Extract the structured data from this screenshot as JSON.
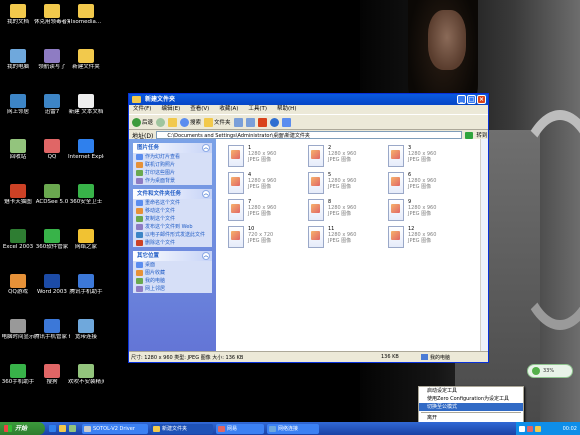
{
  "desktop_icons": [
    {
      "label": "我的文档",
      "color": "#f2c94c"
    },
    {
      "label": "休克用领毒者集",
      "color": "#f2c94c"
    },
    {
      "label": "Isomedia...",
      "color": "#f2c94c"
    },
    {
      "label": "我的电脑",
      "color": "#6fa8dc"
    },
    {
      "label": "领航读写了",
      "color": "#8e7cc3"
    },
    {
      "label": "新建文件夹",
      "color": "#f2c94c"
    },
    {
      "label": "网上邻居",
      "color": "#3d85c6"
    },
    {
      "label": "迅雷7",
      "color": "#3d85c6"
    },
    {
      "label": "新建 文本文档",
      "color": "#eeeeee"
    },
    {
      "label": "回收站",
      "color": "#93c47d"
    },
    {
      "label": "QQ",
      "color": "#e06666"
    },
    {
      "label": "Internet Explorer",
      "color": "#2f80ed"
    },
    {
      "label": "魅卡天猫图",
      "color": "#cc4125"
    },
    {
      "label": "ACDSee 5.0",
      "color": "#6aa84f"
    },
    {
      "label": "360安全卫士",
      "color": "#38b349"
    },
    {
      "label": "Excel 2003",
      "color": "#2e7d32"
    },
    {
      "label": "360软件管家",
      "color": "#38b349"
    },
    {
      "label": "网络之家",
      "color": "#f1c232"
    },
    {
      "label": "QQ游戏",
      "color": "#e69138"
    },
    {
      "label": "Word 2003",
      "color": "#1c4ba6"
    },
    {
      "label": "腾讯手机助手",
      "color": "#3c78d8"
    },
    {
      "label": "电脑时间显示",
      "color": "#999999"
    },
    {
      "label": "腾讯手机管家 for",
      "color": "#3c78d8"
    },
    {
      "label": "宽带连接",
      "color": "#6fa8dc"
    },
    {
      "label": "360手机助手",
      "color": "#38b349"
    },
    {
      "label": "搜狗",
      "color": "#e06666"
    },
    {
      "label": "欢吹不安装精灵",
      "color": "#93c47d"
    }
  ],
  "window": {
    "title": "新建文件夹",
    "menu": [
      "文件(F)",
      "编辑(E)",
      "查看(V)",
      "收藏(A)",
      "工具(T)",
      "帮助(H)"
    ],
    "toolbar": {
      "back_label": "后退",
      "search_label": "搜索",
      "folders_label": "文件夹"
    },
    "address_label": "地址(D)",
    "address_value": "C:\\Documents and Settings\\Administrator\\桌面\\新建文件夹",
    "go_label": "转到",
    "panes": [
      {
        "title": "图片任务",
        "items": [
          "作为幻灯片查看",
          "联机订购照片",
          "打印这些图片",
          "作为桌面背景"
        ]
      },
      {
        "title": "文件和文件夹任务",
        "items": [
          "重命名这个文件",
          "移动这个文件",
          "复制这个文件",
          "发布这个文件到 Web",
          "以电子邮件形式发送此文件",
          "删除这个文件"
        ]
      },
      {
        "title": "其它位置",
        "items": [
          "桌面",
          "图片收藏",
          "我的电脑",
          "网上邻居"
        ]
      }
    ],
    "files": [
      {
        "name": "1",
        "dims": "1280 x 960",
        "type": "JPEG 图像"
      },
      {
        "name": "2",
        "dims": "1280 x 960",
        "type": "JPEG 图像"
      },
      {
        "name": "3",
        "dims": "1280 x 960",
        "type": "JPEG 图像"
      },
      {
        "name": "4",
        "dims": "1280 x 960",
        "type": "JPEG 图像"
      },
      {
        "name": "5",
        "dims": "1280 x 960",
        "type": "JPEG 图像"
      },
      {
        "name": "6",
        "dims": "1280 x 960",
        "type": "JPEG 图像"
      },
      {
        "name": "7",
        "dims": "1280 x 960",
        "type": "JPEG 图像"
      },
      {
        "name": "8",
        "dims": "1280 x 960",
        "type": "JPEG 图像"
      },
      {
        "name": "9",
        "dims": "1280 x 960",
        "type": "JPEG 图像"
      },
      {
        "name": "10",
        "dims": "720 x 720",
        "type": "JPEG 图像"
      },
      {
        "name": "11",
        "dims": "1280 x 960",
        "type": "JPEG 图像"
      },
      {
        "name": "12",
        "dims": "1280 x 960",
        "type": "JPEG 图像"
      }
    ],
    "status": {
      "info": "尺寸: 1280 x 960 类型: JPEG 图像 大小: 136 KB",
      "size": "136 KB",
      "location": "我的电脑"
    }
  },
  "context_menu": {
    "items": [
      "启动设定工具",
      "使用Zero Configuration为设定工具",
      "切换至公模式",
      "离开"
    ],
    "active_index": 2
  },
  "gadget": {
    "text": "33%"
  },
  "taskbar": {
    "start_label": "开始",
    "tasks": [
      {
        "label": "SOTOL-V2 Driver",
        "color": "#cccccc",
        "active": false
      },
      {
        "label": "新建文件夹",
        "color": "#f2c94c",
        "active": true
      },
      {
        "label": "网易",
        "color": "#e06666",
        "active": false
      },
      {
        "label": "网络连接",
        "color": "#6fa8dc",
        "active": false
      }
    ],
    "clock": "00:02"
  }
}
